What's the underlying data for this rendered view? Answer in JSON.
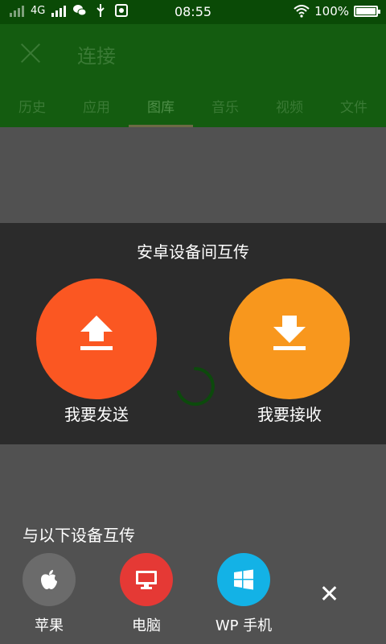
{
  "status_bar": {
    "network_type": "4G",
    "time": "08:55",
    "battery_percent": "100%",
    "battery_level": 1.0,
    "icons": [
      "signal-icon",
      "signal-icon",
      "wechat-icon",
      "usb-icon",
      "debug-icon",
      "wifi-icon",
      "battery-icon"
    ]
  },
  "header": {
    "title": "连接",
    "tabs": [
      {
        "label": "历史"
      },
      {
        "label": "应用"
      },
      {
        "label": "图库"
      },
      {
        "label": "音乐"
      },
      {
        "label": "视频"
      },
      {
        "label": "文件"
      }
    ],
    "active_tab": "图库"
  },
  "transfer_panel": {
    "title": "安卓设备间互传",
    "send_label": "我要发送",
    "receive_label": "我要接收"
  },
  "devices": {
    "title": "与以下设备互传",
    "items": [
      {
        "label": "苹果",
        "icon": "apple-icon"
      },
      {
        "label": "电脑",
        "icon": "monitor-icon"
      },
      {
        "label": "WP 手机",
        "icon": "windows-icon"
      }
    ]
  },
  "colors": {
    "send": "#fb5722",
    "receive": "#f8971d",
    "apple": "#6b6b6b",
    "pc": "#e53935",
    "wp": "#13b2e6",
    "header": "#145c10"
  }
}
